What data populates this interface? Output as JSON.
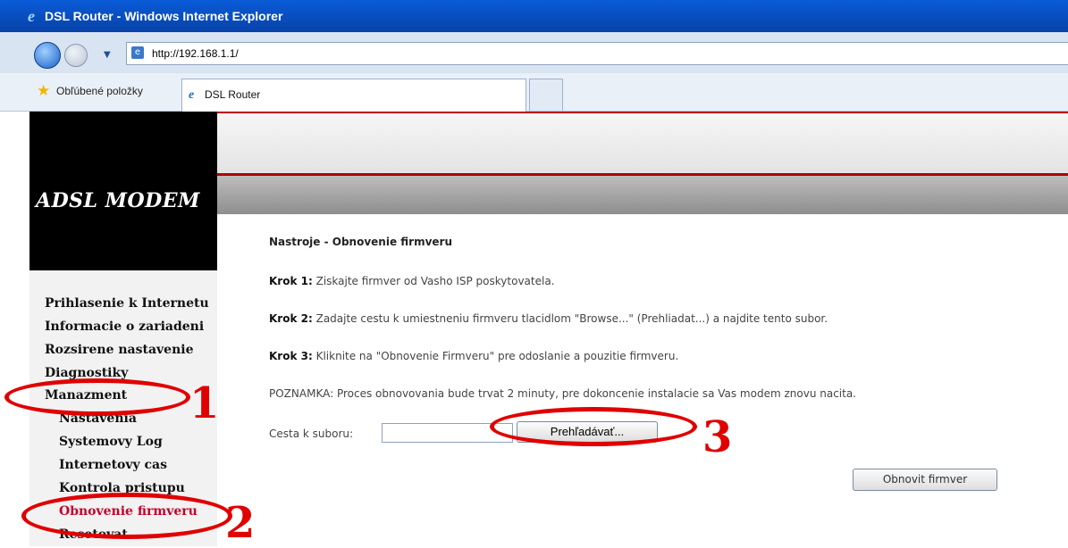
{
  "browser": {
    "window_title": "DSL Router - Windows Internet Explorer",
    "address": "http://192.168.1.1/",
    "favorites_label": "Obľúbené položky",
    "tab_label": "DSL Router"
  },
  "header": {
    "logo_text": "ADSL MODEM"
  },
  "sidebar": {
    "items": [
      {
        "label": "Prihlasenie k Internetu"
      },
      {
        "label": "Informacie o zariadeni"
      },
      {
        "label": "Rozsirene nastavenie"
      },
      {
        "label": "Diagnostiky"
      },
      {
        "label": "Manazment"
      }
    ],
    "subitems": [
      {
        "label": "Nastavenia"
      },
      {
        "label": "Systemovy Log"
      },
      {
        "label": "Internetovy cas"
      },
      {
        "label": "Kontrola pristupu"
      },
      {
        "label": "Obnovenie firmveru"
      },
      {
        "label": "Resetovat"
      }
    ]
  },
  "content": {
    "title": "Nastroje - Obnovenie firmveru",
    "step1_label": "Krok 1:",
    "step1_text": " Ziskajte firmver od Vasho ISP poskytovatela.",
    "step2_label": "Krok 2:",
    "step2_text": " Zadajte cestu k umiestneniu firmveru tlacidlom \"Browse...\" (Prehliadat...) a najdite tento subor.",
    "step3_label": "Krok 3:",
    "step3_text": " Kliknite na \"Obnovenie Firmveru\" pre odoslanie a pouzitie firmveru.",
    "note": "POZNAMKA: Proces obnovovania bude trvat 2 minuty, pre dokoncenie instalacie sa Vas modem znovu nacita.",
    "file_label": "Cesta k suboru:",
    "browse_button": "Prehľadávať...",
    "update_button": "Obnovit firmver"
  },
  "annotations": {
    "num1": "1",
    "num2": "2",
    "num3": "3",
    "color": "#e00000"
  }
}
